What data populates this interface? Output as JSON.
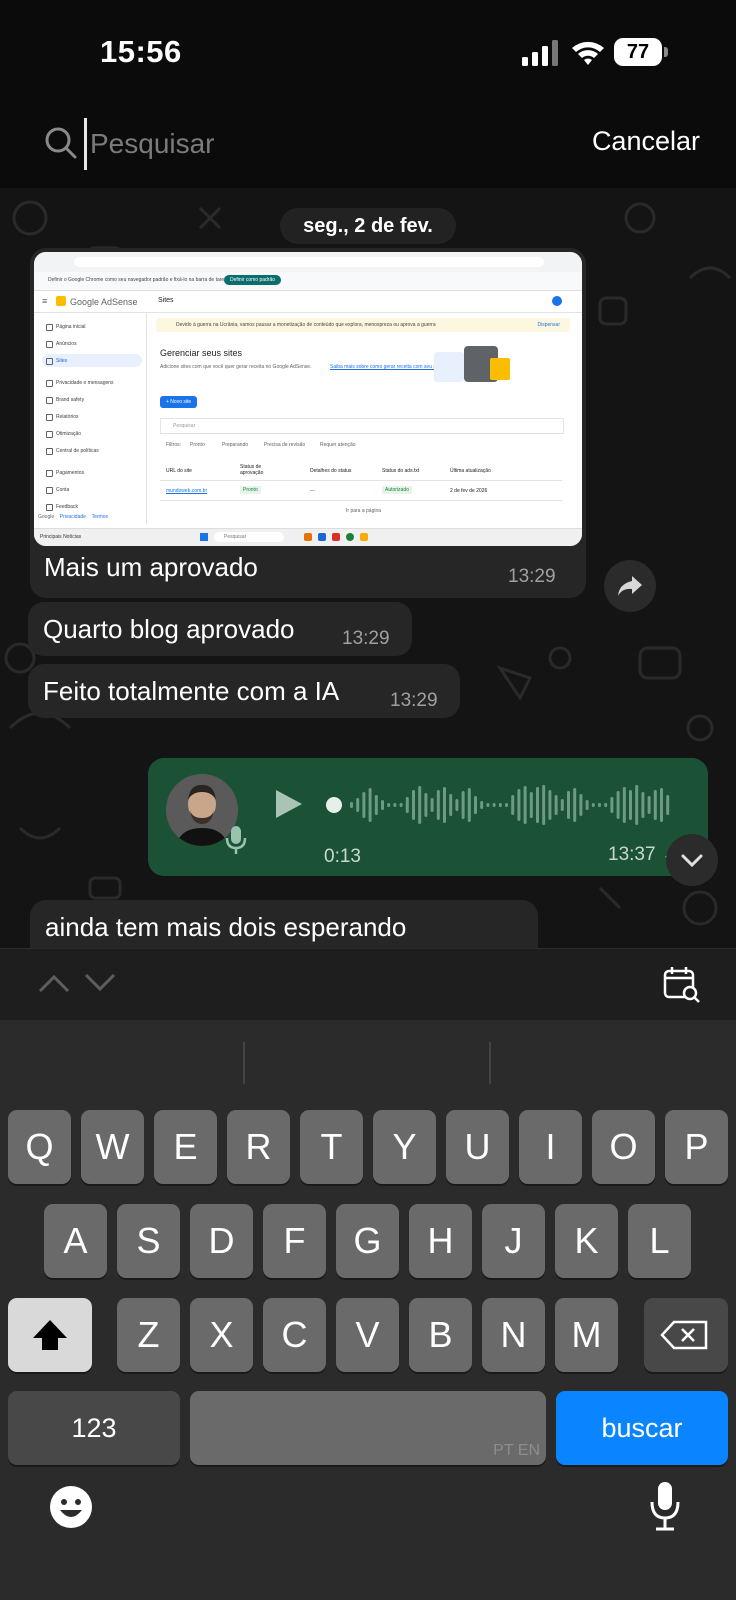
{
  "status_bar": {
    "time": "15:56",
    "battery": "77"
  },
  "search": {
    "placeholder": "Pesquisar",
    "cancel_label": "Cancelar"
  },
  "chat": {
    "date": "seg., 2 de fev.",
    "image_message": {
      "caption": "Mais um aprovado",
      "time": "13:29"
    },
    "text_messages": [
      {
        "text": "Quarto blog aprovado",
        "time": "13:29"
      },
      {
        "text": "Feito totalmente com a IA",
        "time": "13:29"
      }
    ],
    "voice_message": {
      "duration": "0:13",
      "time": "13:37"
    },
    "last_message": {
      "text": "ainda tem mais dois esperando"
    }
  },
  "screenshot": {
    "banner_text": "Definir o Google Chrome como seu navegador padrão e fixá-lo na barra de tarefas",
    "banner_button": "Definir como padrão",
    "brand": "Google AdSense",
    "header": "Sites",
    "nav_items": [
      "Página inicial",
      "Anúncios",
      "Sites",
      "Privacidade e mensagens",
      "Brand safety",
      "Relatórios",
      "Otimização",
      "Central de políticas",
      "Pagamentos",
      "Conta",
      "Feedback"
    ],
    "alert": "Devido à guerra na Ucrânia, vamos pausar a monetização de conteúdo que explora, menospreza ou aprova a guerra",
    "alert_action": "Dispensar",
    "title": "Gerenciar seus sites",
    "subtitle": "Adicione sites com que você quer gerar receita no Google AdSense.",
    "subtitle_link": "Saiba mais sobre como gerar receita com seu site",
    "new_site": "+ Novo site",
    "search_placeholder": "Pesquisar",
    "filters_label": "Filtros:",
    "filters": [
      "Pronto",
      "Preparando",
      "Precisa de revisão",
      "Requer atenção"
    ],
    "columns": [
      "URL do site",
      "Status de aprovação",
      "Detalhes do status",
      "Status do ads.txt",
      "Última atualização"
    ],
    "row": {
      "url": "mundoweb.com.br",
      "approval": "Pronto",
      "details": "—",
      "ads_txt": "Autorizado",
      "updated": "2 de fev de 2026"
    },
    "pagination": "Ir para a página",
    "footer": [
      "Google",
      "Privacidade",
      "Termos"
    ],
    "taskbar_search": "Pesquisar",
    "taskbar_news": "Principais Notícias"
  },
  "keyboard": {
    "row1": [
      "Q",
      "W",
      "E",
      "R",
      "T",
      "Y",
      "U",
      "I",
      "O",
      "P"
    ],
    "row2": [
      "A",
      "S",
      "D",
      "F",
      "G",
      "H",
      "J",
      "K",
      "L"
    ],
    "row3": [
      "Z",
      "X",
      "C",
      "V",
      "B",
      "N",
      "M"
    ],
    "numbers_label": "123",
    "space_language": "PT EN",
    "go_label": "buscar"
  },
  "colors": {
    "outgoing_bubble": "#1b5235",
    "incoming_bubble": "#262626",
    "accent_blue": "#0a84ff"
  }
}
